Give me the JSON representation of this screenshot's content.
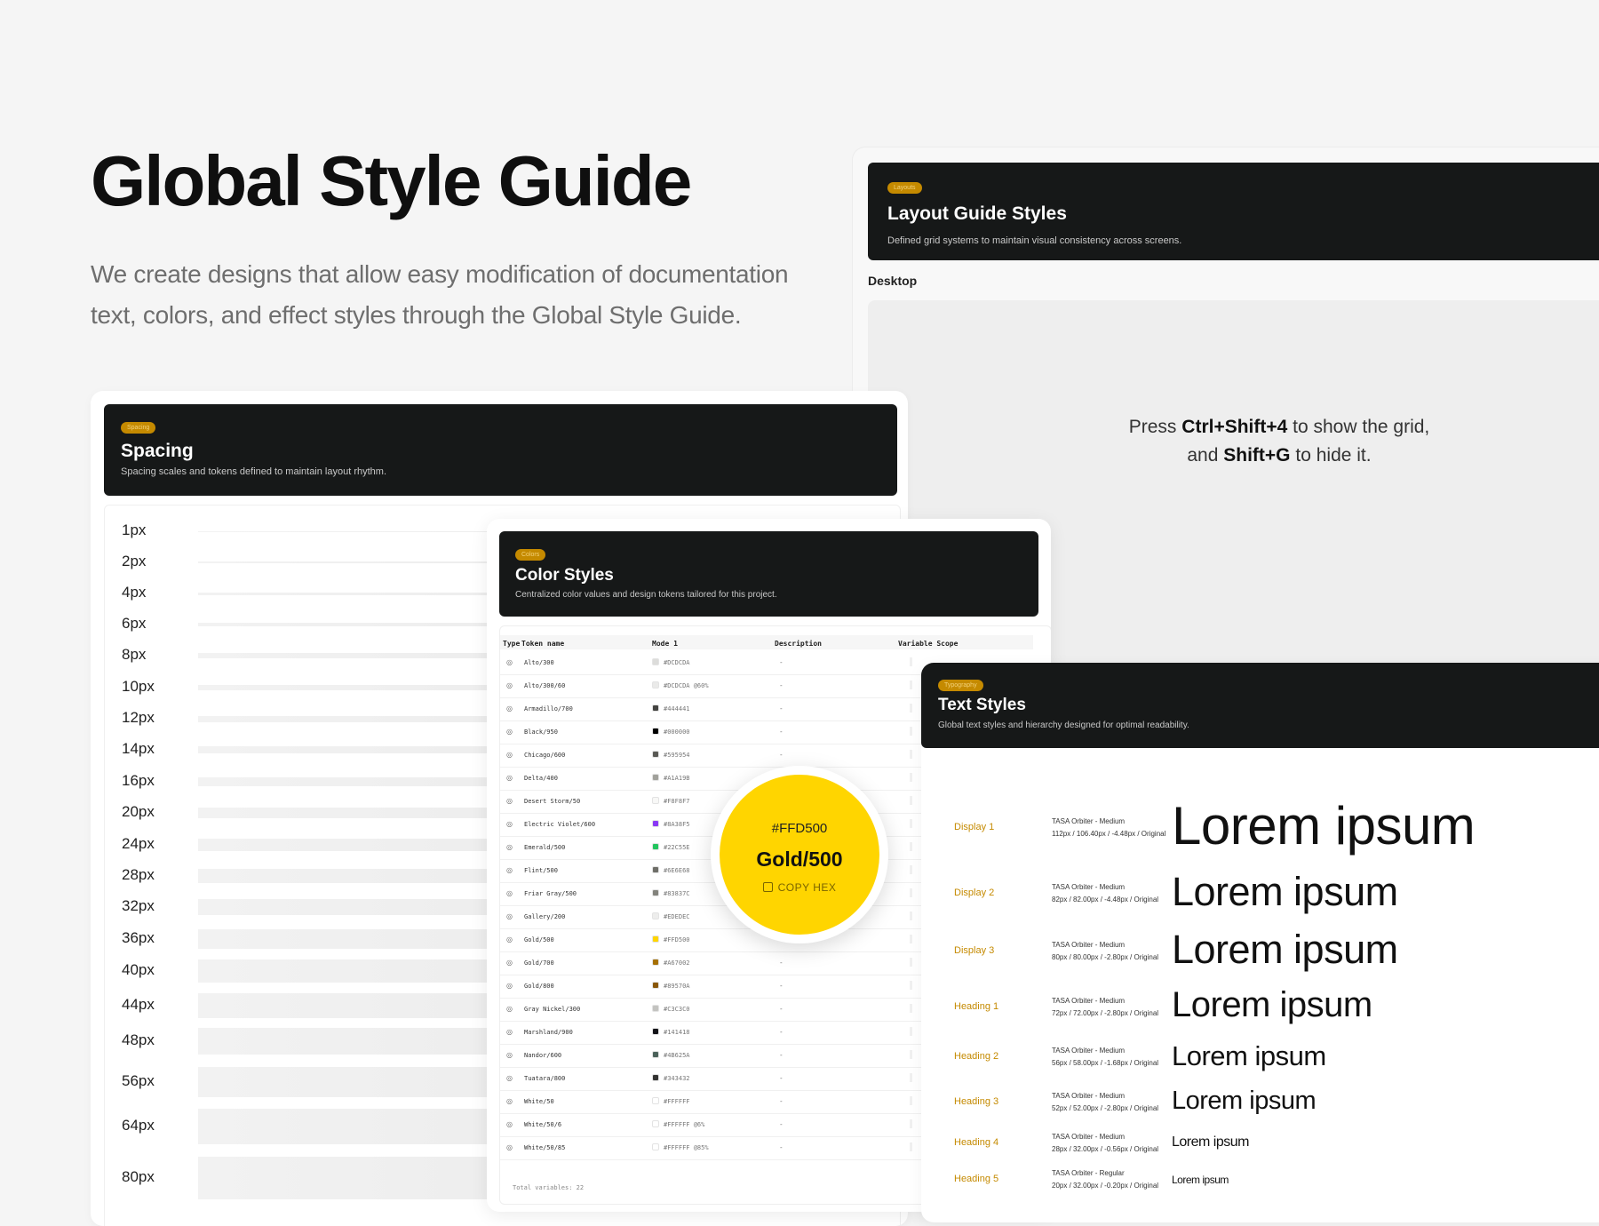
{
  "hero": {
    "title": "Global Style Guide",
    "description": "We create designs that allow easy modification of documentation text, colors, and effect styles through the Global Style Guide."
  },
  "layout_panel": {
    "tag": "Layouts",
    "title": "Layout Guide Styles",
    "description": "Defined grid systems to maintain visual consistency across screens.",
    "section_label": "Desktop",
    "hint_prefix": "Press",
    "hint_key1": "Ctrl+Shift+4",
    "hint_middle": "to show the grid, and",
    "hint_key2": "Shift+G",
    "hint_suffix": "to hide it."
  },
  "spacing_panel": {
    "tag": "Spacing",
    "title": "Spacing",
    "description": "Spacing scales and tokens defined to maintain layout rhythm.",
    "items": [
      "1px",
      "2px",
      "4px",
      "6px",
      "8px",
      "10px",
      "12px",
      "14px",
      "16px",
      "20px",
      "24px",
      "28px",
      "32px",
      "36px",
      "40px",
      "44px",
      "48px",
      "56px",
      "64px",
      "80px"
    ],
    "values": [
      1,
      2,
      4,
      6,
      8,
      10,
      12,
      14,
      16,
      20,
      24,
      28,
      32,
      36,
      40,
      44,
      48,
      56,
      64,
      80
    ]
  },
  "color_panel": {
    "tag": "Colors",
    "title": "Color Styles",
    "description": "Centralized color values and design tokens tailored for this project.",
    "columns": {
      "type": "Type",
      "token": "Token name",
      "mode": "Mode 1",
      "description": "Description",
      "scope": "Variable Scope"
    },
    "rows": [
      {
        "name": "Alto/300",
        "hex": "#DCDCDA",
        "color": "#DCDCDA",
        "desc": "-"
      },
      {
        "name": "Alto/300/60",
        "hex": "#DCDCDA @60%",
        "color": "#EAEAE9",
        "desc": "-"
      },
      {
        "name": "Armadillo/700",
        "hex": "#444441",
        "color": "#444441",
        "desc": "-"
      },
      {
        "name": "Black/950",
        "hex": "#000000",
        "color": "#000000",
        "desc": "-"
      },
      {
        "name": "Chicago/600",
        "hex": "#595954",
        "color": "#595954",
        "desc": "-"
      },
      {
        "name": "Delta/400",
        "hex": "#A1A19B",
        "color": "#A1A19B",
        "desc": "-"
      },
      {
        "name": "Desert Storm/50",
        "hex": "#F8F8F7",
        "color": "#F8F8F7",
        "desc": "-"
      },
      {
        "name": "Electric Violet/600",
        "hex": "#8A38F5",
        "color": "#8A38F5",
        "desc": "-"
      },
      {
        "name": "Emerald/500",
        "hex": "#22C55E",
        "color": "#22C55E",
        "desc": "-"
      },
      {
        "name": "Flint/500",
        "hex": "#6E6E68",
        "color": "#6E6E68",
        "desc": "-"
      },
      {
        "name": "Friar Gray/500",
        "hex": "#83837C",
        "color": "#83837C",
        "desc": "-"
      },
      {
        "name": "Gallery/200",
        "hex": "#EDEDEC",
        "color": "#EDEDEC",
        "desc": "-"
      },
      {
        "name": "Gold/500",
        "hex": "#FFD500",
        "color": "#FFD500",
        "desc": "-"
      },
      {
        "name": "Gold/700",
        "hex": "#A67002",
        "color": "#A67002",
        "desc": "-"
      },
      {
        "name": "Gold/800",
        "hex": "#89570A",
        "color": "#89570A",
        "desc": "-"
      },
      {
        "name": "Gray Nickel/300",
        "hex": "#C3C3C0",
        "color": "#C3C3C0",
        "desc": "-"
      },
      {
        "name": "Marshland/900",
        "hex": "#141418",
        "color": "#141418",
        "desc": "-"
      },
      {
        "name": "Nandor/600",
        "hex": "#4B625A",
        "color": "#4B625A",
        "desc": "-"
      },
      {
        "name": "Tuatara/800",
        "hex": "#343432",
        "color": "#343432",
        "desc": "-"
      },
      {
        "name": "White/50",
        "hex": "#FFFFFF",
        "color": "#FFFFFF",
        "desc": "-"
      },
      {
        "name": "White/50/6",
        "hex": "#FFFFFF @6%",
        "color": "#FFFFFF",
        "desc": "-"
      },
      {
        "name": "White/50/85",
        "hex": "#FFFFFF @85%",
        "color": "#FFFFFF",
        "desc": "-"
      }
    ],
    "total": "Total variables: 22",
    "popup": {
      "hex": "#FFD500",
      "name": "Gold/500",
      "copy_label": "COPY HEX",
      "color": "#FFD500"
    }
  },
  "text_panel": {
    "tag": "Typography",
    "title": "Text Styles",
    "description": "Global text styles and hierarchy designed for optimal readability.",
    "styles": [
      {
        "label": "Display 1",
        "font": "TASA Orbiter - Medium",
        "spec": "112px / 106.40px / -4.48px / Original",
        "sample": "Lorem ipsum"
      },
      {
        "label": "Display 2",
        "font": "TASA Orbiter - Medium",
        "spec": "82px / 82.00px / -4.48px / Original",
        "sample": "Lorem ipsum"
      },
      {
        "label": "Display 3",
        "font": "TASA Orbiter - Medium",
        "spec": "80px / 80.00px / -2.80px / Original",
        "sample": "Lorem ipsum"
      },
      {
        "label": "Heading 1",
        "font": "TASA Orbiter - Medium",
        "spec": "72px / 72.00px / -2.80px / Original",
        "sample": "Lorem ipsum"
      },
      {
        "label": "Heading 2",
        "font": "TASA Orbiter - Medium",
        "spec": "56px / 58.00px / -1.68px / Original",
        "sample": "Lorem ipsum"
      },
      {
        "label": "Heading 3",
        "font": "TASA Orbiter - Medium",
        "spec": "52px / 52.00px / -2.80px / Original",
        "sample": "Lorem ipsum"
      },
      {
        "label": "Heading 4",
        "font": "TASA Orbiter - Medium",
        "spec": "28px / 32.00px / -0.56px / Original",
        "sample": "Lorem ipsum"
      },
      {
        "label": "Heading 5",
        "font": "TASA Orbiter - Regular",
        "spec": "20px / 32.00px / -0.20px / Original",
        "sample": "Lorem ipsum"
      }
    ]
  },
  "colors": {
    "accent": "#C58A00",
    "dark": "#161818",
    "gold": "#FFD500"
  }
}
